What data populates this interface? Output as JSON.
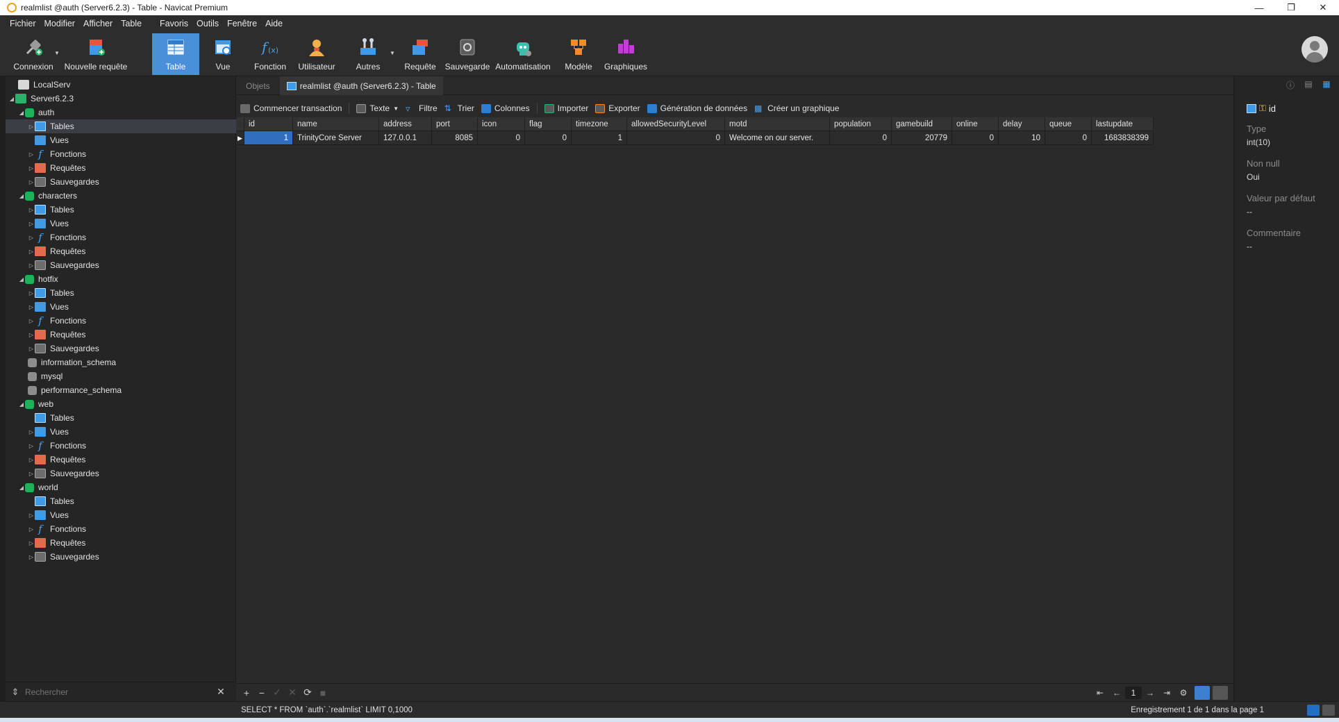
{
  "window": {
    "title": "realmlist @auth (Server6.2.3) - Table - Navicat Premium"
  },
  "menu": [
    "Fichier",
    "Modifier",
    "Afficher",
    "Table",
    "Favoris",
    "Outils",
    "Fenêtre",
    "Aide"
  ],
  "toolbar": {
    "connexion": "Connexion",
    "nouvelle_requete": "Nouvelle requête",
    "table": "Table",
    "vue": "Vue",
    "fonction": "Fonction",
    "utilisateur": "Utilisateur",
    "autres": "Autres",
    "requete": "Requête",
    "sauvegarde": "Sauvegarde",
    "automatisation": "Automatisation",
    "modele": "Modèle",
    "graphiques": "Graphiques"
  },
  "tree": {
    "localserv": "LocalServ",
    "server": "Server6.2.3",
    "databases": {
      "auth": "auth",
      "characters": "characters",
      "hotfix": "hotfix",
      "information_schema": "information_schema",
      "mysql": "mysql",
      "performance_schema": "performance_schema",
      "web": "web",
      "world": "world"
    },
    "nodes": {
      "tables": "Tables",
      "vues": "Vues",
      "fonctions": "Fonctions",
      "requetes": "Requêtes",
      "sauvegardes": "Sauvegardes"
    }
  },
  "search": {
    "placeholder": "Rechercher"
  },
  "tabs": {
    "objets": "Objets",
    "active": "realmlist @auth (Server6.2.3) - Table"
  },
  "objbar": {
    "transaction": "Commencer transaction",
    "texte": "Texte",
    "filtre": "Filtre",
    "trier": "Trier",
    "colonnes": "Colonnes",
    "importer": "Importer",
    "exporter": "Exporter",
    "generation": "Génération de données",
    "graphique": "Créer un graphique"
  },
  "grid": {
    "columns": [
      "id",
      "name",
      "address",
      "port",
      "icon",
      "flag",
      "timezone",
      "allowedSecurityLevel",
      "motd",
      "population",
      "gamebuild",
      "online",
      "delay",
      "queue",
      "lastupdate"
    ],
    "rows": [
      [
        "1",
        "TrinityCore Server",
        "127.0.0.1",
        "8085",
        "0",
        "0",
        "1",
        "0",
        "Welcome on our server.",
        "0",
        "20779",
        "0",
        "10",
        "0",
        "1683838399"
      ]
    ]
  },
  "pager": {
    "page": "1"
  },
  "right_panel": {
    "field_name": "id",
    "type_label": "Type",
    "type_value": "int(10)",
    "notnull_label": "Non null",
    "notnull_value": "Oui",
    "default_label": "Valeur par défaut",
    "default_value": "--",
    "comment_label": "Commentaire",
    "comment_value": "--"
  },
  "status": {
    "sql": "SELECT * FROM `auth`.`realmlist` LIMIT 0,1000",
    "record": "Enregistrement 1 de 1 dans la page 1"
  },
  "colors": {
    "accent": "#4a90d9",
    "selection": "#2f6fbd",
    "db_green": "#20b25a"
  }
}
